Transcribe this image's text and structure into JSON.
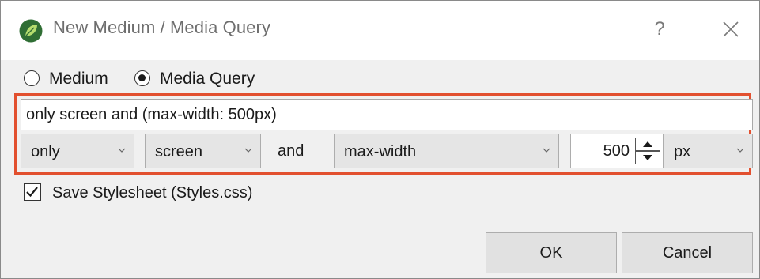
{
  "window": {
    "title": "New Medium / Media Query",
    "help_label": "?",
    "icons": {
      "app": "app-logo-leaf-icon",
      "close": "close-icon"
    }
  },
  "mode": {
    "options": [
      {
        "label": "Medium",
        "selected": false
      },
      {
        "label": "Media Query",
        "selected": true
      }
    ]
  },
  "query": {
    "value": "only screen and (max-width: 500px)",
    "modifier": "only",
    "media_type": "screen",
    "and_label": "and",
    "feature": "max-width",
    "number": "500",
    "unit": "px"
  },
  "save_stylesheet": {
    "label": "Save Stylesheet (Styles.css)",
    "checked": true
  },
  "buttons": {
    "ok": "OK",
    "cancel": "Cancel"
  },
  "colors": {
    "highlight": "#e2502f",
    "logo": "#3a7a3c"
  }
}
